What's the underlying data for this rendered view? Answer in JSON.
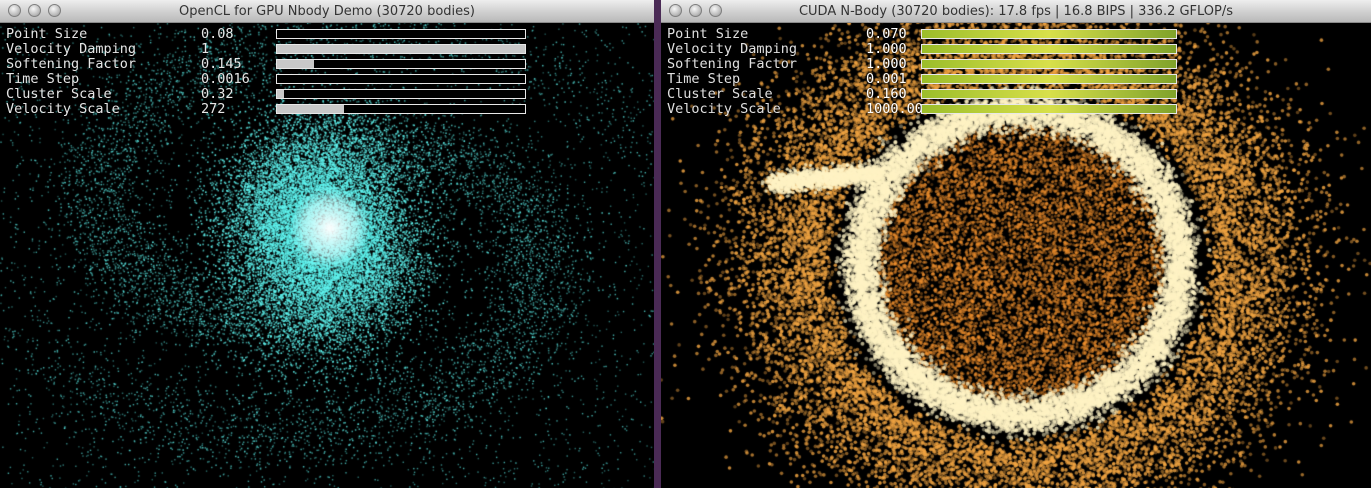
{
  "left_window": {
    "title": "OpenCL for GPU Nbody Demo (30720 bodies)",
    "particle_color": "#5ff5f0",
    "core_color": "#ffffff",
    "params": [
      {
        "label": "Point Size",
        "value": "0.08",
        "fraction": 0.0
      },
      {
        "label": "Velocity Damping",
        "value": "1",
        "fraction": 1.0
      },
      {
        "label": "Softening Factor",
        "value": "0.145",
        "fraction": 0.15
      },
      {
        "label": "Time Step",
        "value": "0.0016",
        "fraction": 0.0
      },
      {
        "label": "Cluster Scale",
        "value": "0.32",
        "fraction": 0.03
      },
      {
        "label": "Velocity Scale",
        "value": "272",
        "fraction": 0.27
      }
    ]
  },
  "right_window": {
    "title": "CUDA N-Body (30720 bodies): 17.8 fps | 16.8 BIPS | 336.2 GFLOP/s",
    "particle_color": "#f2c36a",
    "glow_color": "#fff3c4",
    "params": [
      {
        "label": "Point Size",
        "value": "0.070",
        "fraction": 1.0
      },
      {
        "label": "Velocity Damping",
        "value": "1.000",
        "fraction": 1.0
      },
      {
        "label": "Softening Factor",
        "value": "1.000",
        "fraction": 1.0
      },
      {
        "label": "Time Step",
        "value": "0.001",
        "fraction": 1.0
      },
      {
        "label": "Cluster Scale",
        "value": "0.160",
        "fraction": 1.0
      },
      {
        "label": "Velocity Scale",
        "value": "1000.00",
        "fraction": 1.0
      }
    ]
  },
  "window_controls": [
    "close-button",
    "minimize-button",
    "zoom-button"
  ]
}
